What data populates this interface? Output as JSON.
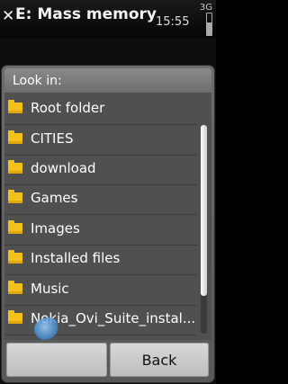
{
  "statusbar": {
    "close_glyph": "✕",
    "title": "E: Mass memory",
    "time": "15:55",
    "indicator": "3G"
  },
  "dialog": {
    "title": "Look in:",
    "items": [
      {
        "label": "Root folder",
        "icon": "folder-icon"
      },
      {
        "label": "CITIES",
        "icon": "folder-icon"
      },
      {
        "label": "download",
        "icon": "folder-icon"
      },
      {
        "label": "Games",
        "icon": "folder-icon"
      },
      {
        "label": "Images",
        "icon": "folder-icon"
      },
      {
        "label": "Installed files",
        "icon": "folder-icon"
      },
      {
        "label": "Music",
        "icon": "folder-icon"
      },
      {
        "label": "Nokia_Ovi_Suite_instal...",
        "icon": "folder-icon"
      }
    ],
    "buttons": {
      "left_label": "",
      "right_label": "Back"
    }
  },
  "colors": {
    "folder": "#f3c21a",
    "dialog_bg": "#585858",
    "button_bg": "#d0d0d0"
  }
}
